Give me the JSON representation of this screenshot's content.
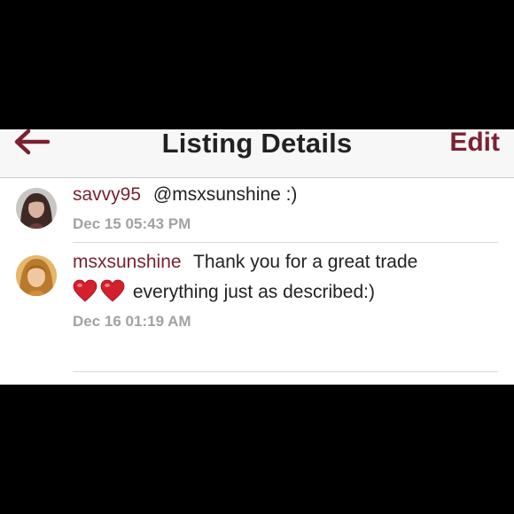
{
  "colors": {
    "accent": "#7a2232",
    "background": "#000000",
    "navbar_bg": "#f7f7f7",
    "text": "#222222",
    "muted": "#a2a2a2",
    "divider": "#d8d8d8",
    "heart": "#d41f2c"
  },
  "navbar": {
    "back_icon": "arrow-left-icon",
    "title": "Listing Details",
    "edit_label": "Edit"
  },
  "comments": [
    {
      "username": "savvy95",
      "message_lines": [
        "@msxsunshine :)"
      ],
      "timestamp": "Dec 15 05:43 PM",
      "avatar_icon": "user-avatar"
    },
    {
      "username": "msxsunshine",
      "message_lines": [
        "Thank you for a great trade",
        "everything just as described:)"
      ],
      "emoji": "heart-icon",
      "emoji_count": 2,
      "timestamp": "Dec 16 01:19 AM",
      "avatar_icon": "user-avatar"
    }
  ]
}
